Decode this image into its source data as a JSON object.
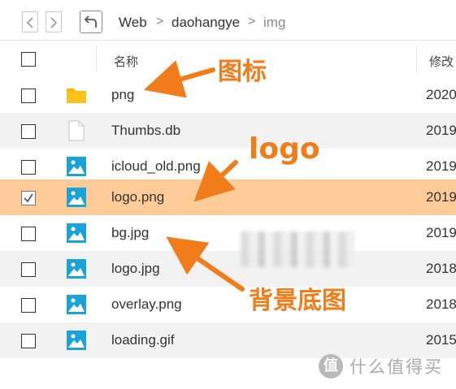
{
  "breadcrumb": {
    "items": [
      "Web",
      "daohangye",
      "img"
    ],
    "separator": ">"
  },
  "header": {
    "name_label": "名称",
    "modified_label": "修改"
  },
  "files": [
    {
      "name": "png",
      "date": "2020",
      "icon": "folder-icon",
      "checked": false
    },
    {
      "name": "Thumbs.db",
      "date": "2019",
      "icon": "file-icon",
      "checked": false
    },
    {
      "name": "icloud_old.png",
      "date": "2019",
      "icon": "image-icon",
      "checked": false
    },
    {
      "name": "logo.png",
      "date": "2019",
      "icon": "image-icon",
      "checked": true
    },
    {
      "name": "bg.jpg",
      "date": "2019",
      "icon": "image-icon",
      "checked": false
    },
    {
      "name": "logo.jpg",
      "date": "2018",
      "icon": "image-icon",
      "checked": false
    },
    {
      "name": "overlay.png",
      "date": "2018",
      "icon": "image-icon",
      "checked": false
    },
    {
      "name": "loading.gif",
      "date": "2015",
      "icon": "image-icon",
      "checked": false
    }
  ],
  "annotations": {
    "icon_label": "图标",
    "logo_label": "logo",
    "background_label": "背景底图"
  },
  "watermark": {
    "logo_char": "值",
    "text": "什么值得买"
  },
  "colors": {
    "accent": "#f07c1a",
    "selected_row": "#ffcc99",
    "image_icon": "#1aa3d9",
    "folder_icon": "#f7b500"
  }
}
